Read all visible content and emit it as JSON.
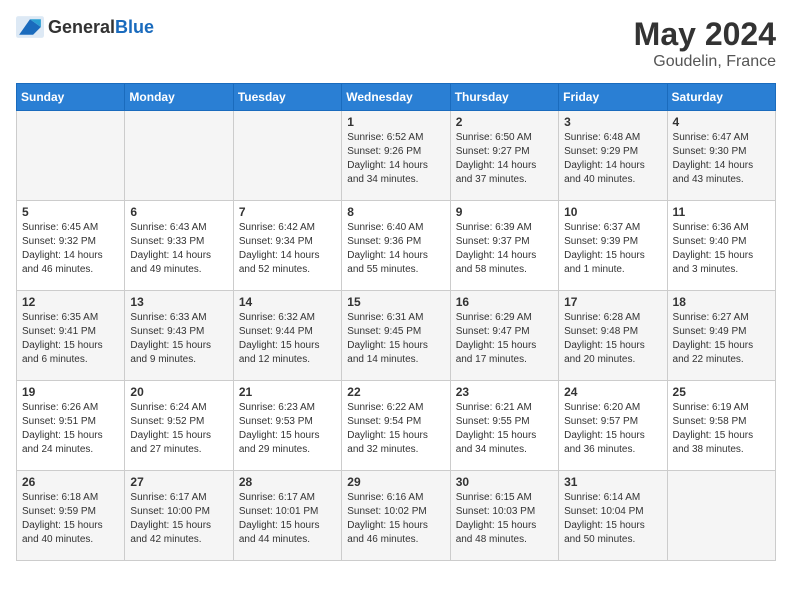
{
  "header": {
    "logo_general": "General",
    "logo_blue": "Blue",
    "title": "May 2024",
    "location": "Goudelin, France"
  },
  "weekdays": [
    "Sunday",
    "Monday",
    "Tuesday",
    "Wednesday",
    "Thursday",
    "Friday",
    "Saturday"
  ],
  "weeks": [
    [
      {
        "day": "",
        "info": ""
      },
      {
        "day": "",
        "info": ""
      },
      {
        "day": "",
        "info": ""
      },
      {
        "day": "1",
        "info": "Sunrise: 6:52 AM\nSunset: 9:26 PM\nDaylight: 14 hours\nand 34 minutes."
      },
      {
        "day": "2",
        "info": "Sunrise: 6:50 AM\nSunset: 9:27 PM\nDaylight: 14 hours\nand 37 minutes."
      },
      {
        "day": "3",
        "info": "Sunrise: 6:48 AM\nSunset: 9:29 PM\nDaylight: 14 hours\nand 40 minutes."
      },
      {
        "day": "4",
        "info": "Sunrise: 6:47 AM\nSunset: 9:30 PM\nDaylight: 14 hours\nand 43 minutes."
      }
    ],
    [
      {
        "day": "5",
        "info": "Sunrise: 6:45 AM\nSunset: 9:32 PM\nDaylight: 14 hours\nand 46 minutes."
      },
      {
        "day": "6",
        "info": "Sunrise: 6:43 AM\nSunset: 9:33 PM\nDaylight: 14 hours\nand 49 minutes."
      },
      {
        "day": "7",
        "info": "Sunrise: 6:42 AM\nSunset: 9:34 PM\nDaylight: 14 hours\nand 52 minutes."
      },
      {
        "day": "8",
        "info": "Sunrise: 6:40 AM\nSunset: 9:36 PM\nDaylight: 14 hours\nand 55 minutes."
      },
      {
        "day": "9",
        "info": "Sunrise: 6:39 AM\nSunset: 9:37 PM\nDaylight: 14 hours\nand 58 minutes."
      },
      {
        "day": "10",
        "info": "Sunrise: 6:37 AM\nSunset: 9:39 PM\nDaylight: 15 hours\nand 1 minute."
      },
      {
        "day": "11",
        "info": "Sunrise: 6:36 AM\nSunset: 9:40 PM\nDaylight: 15 hours\nand 3 minutes."
      }
    ],
    [
      {
        "day": "12",
        "info": "Sunrise: 6:35 AM\nSunset: 9:41 PM\nDaylight: 15 hours\nand 6 minutes."
      },
      {
        "day": "13",
        "info": "Sunrise: 6:33 AM\nSunset: 9:43 PM\nDaylight: 15 hours\nand 9 minutes."
      },
      {
        "day": "14",
        "info": "Sunrise: 6:32 AM\nSunset: 9:44 PM\nDaylight: 15 hours\nand 12 minutes."
      },
      {
        "day": "15",
        "info": "Sunrise: 6:31 AM\nSunset: 9:45 PM\nDaylight: 15 hours\nand 14 minutes."
      },
      {
        "day": "16",
        "info": "Sunrise: 6:29 AM\nSunset: 9:47 PM\nDaylight: 15 hours\nand 17 minutes."
      },
      {
        "day": "17",
        "info": "Sunrise: 6:28 AM\nSunset: 9:48 PM\nDaylight: 15 hours\nand 20 minutes."
      },
      {
        "day": "18",
        "info": "Sunrise: 6:27 AM\nSunset: 9:49 PM\nDaylight: 15 hours\nand 22 minutes."
      }
    ],
    [
      {
        "day": "19",
        "info": "Sunrise: 6:26 AM\nSunset: 9:51 PM\nDaylight: 15 hours\nand 24 minutes."
      },
      {
        "day": "20",
        "info": "Sunrise: 6:24 AM\nSunset: 9:52 PM\nDaylight: 15 hours\nand 27 minutes."
      },
      {
        "day": "21",
        "info": "Sunrise: 6:23 AM\nSunset: 9:53 PM\nDaylight: 15 hours\nand 29 minutes."
      },
      {
        "day": "22",
        "info": "Sunrise: 6:22 AM\nSunset: 9:54 PM\nDaylight: 15 hours\nand 32 minutes."
      },
      {
        "day": "23",
        "info": "Sunrise: 6:21 AM\nSunset: 9:55 PM\nDaylight: 15 hours\nand 34 minutes."
      },
      {
        "day": "24",
        "info": "Sunrise: 6:20 AM\nSunset: 9:57 PM\nDaylight: 15 hours\nand 36 minutes."
      },
      {
        "day": "25",
        "info": "Sunrise: 6:19 AM\nSunset: 9:58 PM\nDaylight: 15 hours\nand 38 minutes."
      }
    ],
    [
      {
        "day": "26",
        "info": "Sunrise: 6:18 AM\nSunset: 9:59 PM\nDaylight: 15 hours\nand 40 minutes."
      },
      {
        "day": "27",
        "info": "Sunrise: 6:17 AM\nSunset: 10:00 PM\nDaylight: 15 hours\nand 42 minutes."
      },
      {
        "day": "28",
        "info": "Sunrise: 6:17 AM\nSunset: 10:01 PM\nDaylight: 15 hours\nand 44 minutes."
      },
      {
        "day": "29",
        "info": "Sunrise: 6:16 AM\nSunset: 10:02 PM\nDaylight: 15 hours\nand 46 minutes."
      },
      {
        "day": "30",
        "info": "Sunrise: 6:15 AM\nSunset: 10:03 PM\nDaylight: 15 hours\nand 48 minutes."
      },
      {
        "day": "31",
        "info": "Sunrise: 6:14 AM\nSunset: 10:04 PM\nDaylight: 15 hours\nand 50 minutes."
      },
      {
        "day": "",
        "info": ""
      }
    ]
  ]
}
